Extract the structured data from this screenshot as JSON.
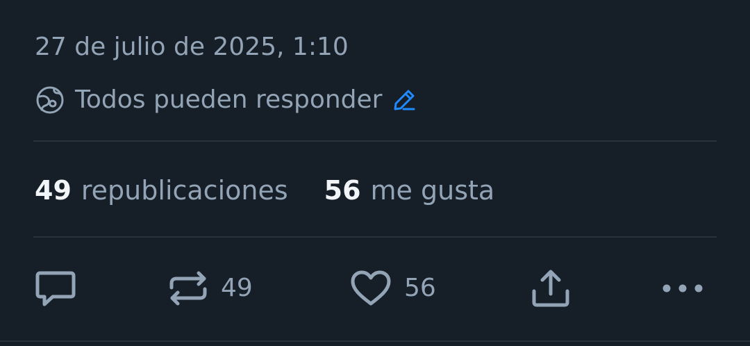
{
  "post": {
    "timestamp": "27 de julio de 2025, 1:10",
    "reply_setting": {
      "icon": "globe-icon",
      "label": "Todos pueden responder",
      "edit_icon": "pencil-icon"
    },
    "stats": {
      "reposts": {
        "count": "49",
        "label": "republicaciones"
      },
      "likes": {
        "count": "56",
        "label": "me gusta"
      }
    },
    "actions": {
      "reply": {
        "icon": "speech-bubble-icon"
      },
      "repost": {
        "icon": "repost-arrows-icon",
        "count": "49"
      },
      "like": {
        "icon": "heart-icon",
        "count": "56"
      },
      "share": {
        "icon": "share-upload-icon"
      },
      "more": {
        "icon": "ellipsis-icon"
      }
    }
  },
  "colors": {
    "background": "#161e27",
    "muted_text": "#93a4b6",
    "primary_text": "#f2f5f8",
    "accent": "#208bfe",
    "divider": "#27313c"
  }
}
